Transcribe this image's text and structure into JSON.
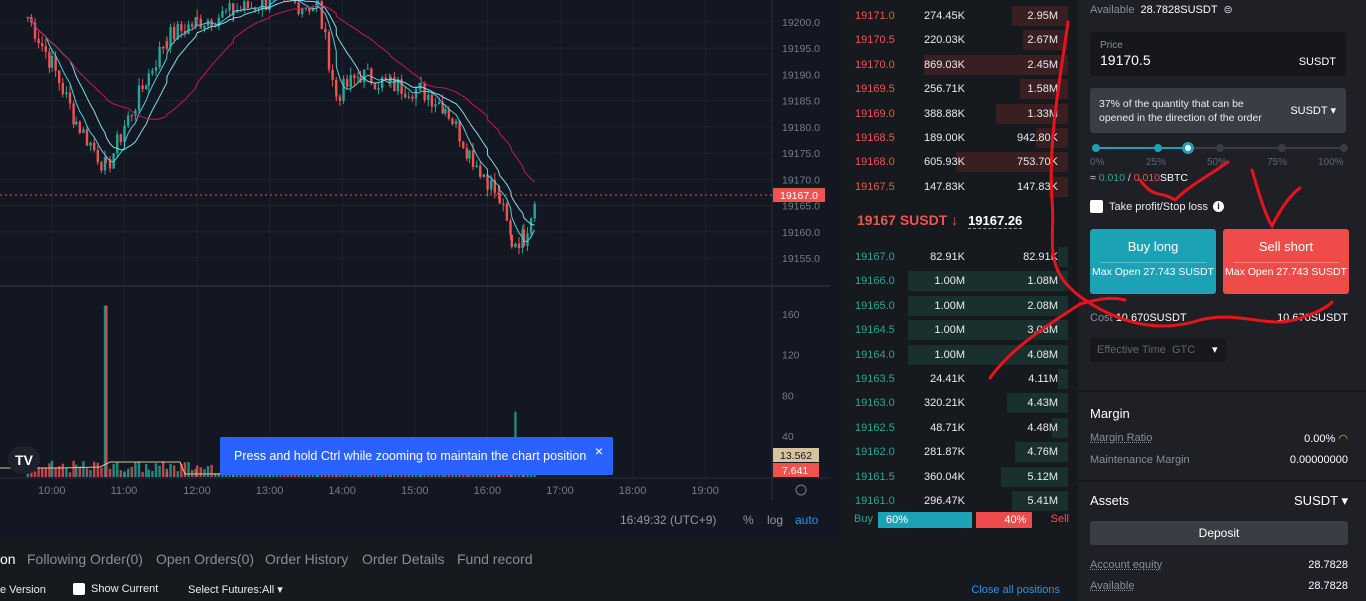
{
  "chart": {
    "price_ticks": [
      "19200.0",
      "19195.0",
      "19190.0",
      "19185.0",
      "19180.0",
      "19175.0",
      "19170.0",
      "19165.0",
      "19160.0",
      "19155.0"
    ],
    "price_tick_values": [
      19200,
      19195,
      19190,
      19185,
      19180,
      19175,
      19170,
      19165,
      19160,
      19155
    ],
    "last_price_label": "19167.0",
    "last_price": 19167.0,
    "volume_ticks": [
      "160",
      "120",
      "80",
      "40"
    ],
    "volume_tick_values": [
      160,
      120,
      80,
      40
    ],
    "vol_label_1": "13.562",
    "vol_label_2": "7.641",
    "time_ticks": [
      "10:00",
      "11:00",
      "12:00",
      "13:00",
      "14:00",
      "15:00",
      "16:00",
      "17:00",
      "18:00",
      "19:00"
    ],
    "price_path": [
      [
        "09:40",
        19201
      ],
      [
        "10:00",
        19192
      ],
      [
        "10:20",
        19181
      ],
      [
        "10:45",
        19172
      ],
      [
        "11:00",
        19180
      ],
      [
        "11:20",
        19190
      ],
      [
        "11:35",
        19197
      ],
      [
        "12:00",
        19200
      ],
      [
        "12:30",
        19202
      ],
      [
        "13:00",
        19204
      ],
      [
        "13:40",
        19203
      ],
      [
        "13:55",
        19186
      ],
      [
        "14:15",
        19190
      ],
      [
        "14:40",
        19188
      ],
      [
        "15:05",
        19187
      ],
      [
        "15:25",
        19184
      ],
      [
        "15:45",
        19175
      ],
      [
        "16:00",
        19170
      ],
      [
        "16:10",
        19166
      ],
      [
        "16:20",
        19158
      ],
      [
        "16:30",
        19159
      ],
      [
        "16:40",
        19167
      ]
    ],
    "colors": {
      "up": "#26a69a",
      "down": "#ef5350",
      "ma1": "#c2185b",
      "ma2": "#4dd0e1"
    },
    "toast": "Press and hold Ctrl while zooming to maintain the chart position",
    "toast_close": "×",
    "logo": "TV",
    "clock": "16:49:32 (UTC+9)",
    "pct": "%",
    "log": "log",
    "auto": "auto"
  },
  "orderbook": {
    "asks": [
      [
        "19171.0",
        "274.45K",
        "2.95M",
        0.35
      ],
      [
        "19170.5",
        "220.03K",
        "2.67M",
        0.28
      ],
      [
        "19170.0",
        "869.03K",
        "2.45M",
        0.9
      ],
      [
        "19169.5",
        "256.71K",
        "1.58M",
        0.3
      ],
      [
        "19169.0",
        "388.88K",
        "1.33M",
        0.45
      ],
      [
        "19168.5",
        "189.00K",
        "942.80K",
        0.2
      ],
      [
        "19168.0",
        "605.93K",
        "753.70K",
        0.7
      ],
      [
        "19167.5",
        "147.83K",
        "147.83K",
        0.12
      ]
    ],
    "mid_price": "19167 SUSDT ↓",
    "mark_price": "19167.26",
    "bids": [
      [
        "19167.0",
        "82.91K",
        "82.91K",
        0.06
      ],
      [
        "19166.0",
        "1.00M",
        "1.08M",
        1.0
      ],
      [
        "19165.0",
        "1.00M",
        "2.08M",
        1.0
      ],
      [
        "19164.5",
        "1.00M",
        "3.08M",
        1.0
      ],
      [
        "19164.0",
        "1.00M",
        "4.08M",
        1.0
      ],
      [
        "19163.5",
        "24.41K",
        "4.11M",
        0.06
      ],
      [
        "19163.0",
        "320.21K",
        "4.43M",
        0.38
      ],
      [
        "19162.5",
        "48.71K",
        "4.48M",
        0.1
      ],
      [
        "19162.0",
        "281.87K",
        "4.76M",
        0.33
      ],
      [
        "19161.5",
        "360.04K",
        "5.12M",
        0.42
      ],
      [
        "19161.0",
        "296.47K",
        "5.41M",
        0.35
      ]
    ],
    "buy_label": "Buy",
    "buy_pct": "60%",
    "buy_ratio": 60,
    "sell_pct": "40%",
    "sell_label": "Sell"
  },
  "order": {
    "available_label": "Available",
    "available_value": "28.7828SUSDT",
    "price_label": "Price",
    "price_value": "19170.5",
    "price_unit": "SUSDT",
    "qty_text": "37% of the quantity that can be opened in the direction of the order",
    "qty_unit": "SUSDT",
    "slider_value": 37,
    "slider_marks": [
      "0%",
      "25%",
      "50%",
      "75%",
      "100%"
    ],
    "approx": "≈",
    "qty_buy": "0.010",
    "qty_sep": "/",
    "qty_sell": "0.010",
    "qty_asset": "SBTC",
    "tpsl_label": "Take profit/Stop loss",
    "tpsl_checked": false,
    "buy_label": "Buy long",
    "buy_sub": "Max Open 27.743 SUSDT",
    "sell_label": "Sell short",
    "sell_sub": "Max Open 27.743 SUSDT",
    "cost_label": "Cost",
    "cost_buy": "10.670SUSDT",
    "cost_sell": "10.670SUSDT",
    "eff_label": "Effective Time",
    "eff_value": "GTC"
  },
  "margin": {
    "title": "Margin",
    "ratio_label": "Margin Ratio",
    "ratio_value": "0.00%",
    "maint_label": "Maintenance Margin",
    "maint_value": "0.00000000"
  },
  "assets": {
    "title": "Assets",
    "currency": "SUSDT",
    "deposit": "Deposit",
    "equity_label": "Account equity",
    "equity_value": "28.7828",
    "avail_label": "Available",
    "avail_value": "28.7828"
  },
  "bottom": {
    "tabs": [
      "on",
      "Following Order(0)",
      "Open Orders(0)",
      "Order History",
      "Order Details",
      "Fund record"
    ],
    "simple_version": "e Version",
    "show_current": "Show Current",
    "select_futures": "Select Futures:All",
    "close_all": "Close all positions"
  }
}
